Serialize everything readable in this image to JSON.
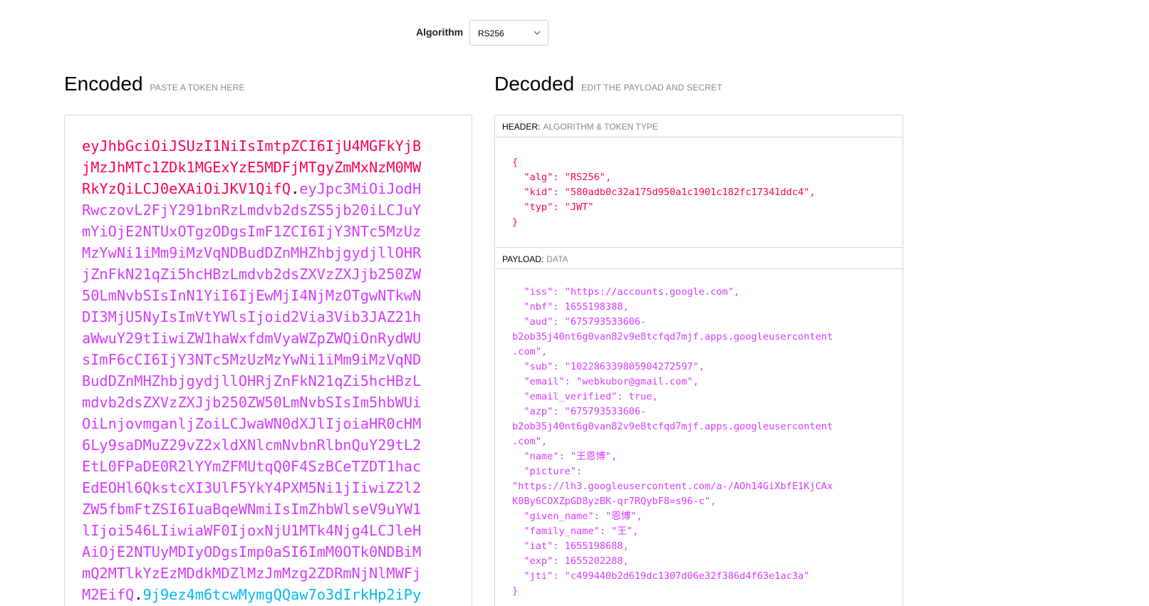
{
  "algorithm": {
    "label": "Algorithm",
    "selected": "RS256"
  },
  "encoded": {
    "title": "Encoded",
    "subtitle": "PASTE A TOKEN HERE",
    "lines": [
      [
        {
          "t": "header",
          "v": "eyJhbGciOiJSUzI1NiIsImtpZCI6IjU4MGFkYjB"
        }
      ],
      [
        {
          "t": "header",
          "v": "jMzJhMTc1ZDk1MGExYzE5MDFjMTgyZmMxNzM0MW"
        }
      ],
      [
        {
          "t": "header",
          "v": "RkYzQiLCJ0eXAiOiJKV1QifQ"
        },
        {
          "t": "dot",
          "v": "."
        },
        {
          "t": "payload",
          "v": "eyJpc3MiOiJodH"
        }
      ],
      [
        {
          "t": "payload",
          "v": "RwczovL2FjY291bnRzLmdvb2dsZS5jb20iLCJuY"
        }
      ],
      [
        {
          "t": "payload",
          "v": "mYiOjE2NTUxOTgzODgsImF1ZCI6IjY3NTc5MzUz"
        }
      ],
      [
        {
          "t": "payload",
          "v": "MzYwNi1iMm9iMzVqNDBudDZnMHZhbjgydjllOHR"
        }
      ],
      [
        {
          "t": "payload",
          "v": "jZnFkN21qZi5hcHBzLmdvb2dsZXVzZXJjb250ZW"
        }
      ],
      [
        {
          "t": "payload",
          "v": "50LmNvbSIsInN1YiI6IjEwMjI4NjMzOTgwNTkwN"
        }
      ],
      [
        {
          "t": "payload",
          "v": "DI3MjU5NyIsImVtYWlsIjoid2Via3Vib3JAZ21h"
        }
      ],
      [
        {
          "t": "payload",
          "v": "aWwuY29tIiwiZW1haWxfdmVyaWZpZWQiOnRydWU"
        }
      ],
      [
        {
          "t": "payload",
          "v": "sImF6cCI6IjY3NTc5MzUzMzYwNi1iMm9iMzVqND"
        }
      ],
      [
        {
          "t": "payload",
          "v": "BudDZnMHZhbjgydjllOHRjZnFkN21qZi5hcHBzL"
        }
      ],
      [
        {
          "t": "payload",
          "v": "mdvb2dsZXVzZXJjb250ZW50LmNvbSIsIm5hbWUi"
        }
      ],
      [
        {
          "t": "payload",
          "v": "OiLnjovmganljZoiLCJwaWN0dXJlIjoiaHR0cHM"
        }
      ],
      [
        {
          "t": "payload",
          "v": "6Ly9saDMuZ29vZ2xldXNlcmNvbnRlbnQuY29tL2"
        }
      ],
      [
        {
          "t": "payload",
          "v": "EtL0FPaDE0R2lYYmZFMUtqQ0F4SzBCeTZDT1hac"
        }
      ],
      [
        {
          "t": "payload",
          "v": "EdEOHl6QkstcXI3UlF5YkY4PXM5Ni1jIiwiZ2l2"
        }
      ],
      [
        {
          "t": "payload",
          "v": "ZW5fbmFtZSI6IuaBqeWNmiIsImZhbWlseV9uYW1"
        }
      ],
      [
        {
          "t": "payload",
          "v": "lIjoi546LIiwiaWF0IjoxNjU1MTk4Njg4LCJleH"
        }
      ],
      [
        {
          "t": "payload",
          "v": "AiOjE2NTUyMDIyODgsImp0aSI6ImM0OTk0NDBiM"
        }
      ],
      [
        {
          "t": "payload",
          "v": "mQ2MTlkYzEzMDdkMDZlMzJmMzg2ZDRmNjNlMWFj"
        }
      ],
      [
        {
          "t": "payload",
          "v": "M2EifQ"
        },
        {
          "t": "dot",
          "v": "."
        },
        {
          "t": "sig",
          "v": "9j9ez4m6tcwMymgQQaw7o3dIrkHp2iPy"
        }
      ]
    ]
  },
  "decoded": {
    "title": "Decoded",
    "subtitle": "EDIT THE PAYLOAD AND SECRET",
    "header_section": {
      "label": "HEADER:",
      "sublabel": "ALGORITHM & TOKEN TYPE",
      "code": "{\n  \"alg\": \"RS256\",\n  \"kid\": \"580adb0c32a175d950a1c1901c182fc17341ddc4\",\n  \"typ\": \"JWT\"\n}"
    },
    "payload_section": {
      "label": "PAYLOAD:",
      "sublabel": "DATA",
      "code": "  \"iss\": \"https://accounts.google.com\",\n  \"nbf\": 1655198388,\n  \"aud\": \"675793533606-\nb2ob35j40nt6g0van82v9e8tcfqd7mjf.apps.googleusercontent\n.com\",\n  \"sub\": \"102286339805904272597\",\n  \"email\": \"webkubor@gmail.com\",\n  \"email_verified\": true,\n  \"azp\": \"675793533606-\nb2ob35j40nt6g0van82v9e8tcfqd7mjf.apps.googleusercontent\n.com\",\n  \"name\": \"王恩博\",\n  \"picture\":\n\"https://lh3.googleusercontent.com/a-/AOh14GiXbfE1KjCAx\nK0By6COXZpGD8yzBK-qr7RQybF8=s96-c\",\n  \"given_name\": \"恩博\",\n  \"family_name\": \"王\",\n  \"iat\": 1655198688,\n  \"exp\": 1655202288,\n  \"jti\": \"c499440b2d619dc1307d06e32f386d4f63e1ac3a\"\n}"
    }
  },
  "colors": {
    "header": "#fb015b",
    "payload": "#d63aff",
    "signature": "#00b9f1"
  }
}
